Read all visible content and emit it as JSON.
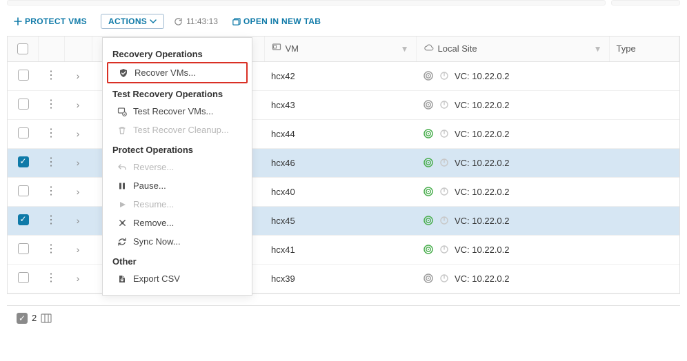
{
  "toolbar": {
    "protect_label": "PROTECT VMS",
    "actions_label": "ACTIONS",
    "time": "11:43:13",
    "open_tab_label": "OPEN IN NEW TAB"
  },
  "menu": {
    "sections": [
      {
        "title": "Recovery Operations",
        "items": [
          {
            "icon": "shield-icon",
            "label": "Recover VMs...",
            "disabled": false,
            "highlighted": true
          }
        ]
      },
      {
        "title": "Test Recovery Operations",
        "items": [
          {
            "icon": "test-recover-icon",
            "label": "Test Recover VMs...",
            "disabled": false
          },
          {
            "icon": "trash-icon",
            "label": "Test Recover Cleanup...",
            "disabled": true
          }
        ]
      },
      {
        "title": "Protect Operations",
        "items": [
          {
            "icon": "reverse-icon",
            "label": "Reverse...",
            "disabled": true
          },
          {
            "icon": "pause-icon",
            "label": "Pause...",
            "disabled": false
          },
          {
            "icon": "resume-icon",
            "label": "Resume...",
            "disabled": true
          },
          {
            "icon": "remove-icon",
            "label": "Remove...",
            "disabled": false
          },
          {
            "icon": "sync-icon",
            "label": "Sync Now...",
            "disabled": false
          }
        ]
      },
      {
        "title": "Other",
        "items": [
          {
            "icon": "export-icon",
            "label": "Export CSV",
            "disabled": false
          }
        ]
      }
    ]
  },
  "columns": {
    "vm": "VM",
    "local_site": "Local Site",
    "type": "Type"
  },
  "rows": [
    {
      "selected": false,
      "vm": "hcx42",
      "status": "gray",
      "site": "VC: 10.22.0.2"
    },
    {
      "selected": false,
      "vm": "hcx43",
      "status": "gray",
      "site": "VC: 10.22.0.2"
    },
    {
      "selected": false,
      "vm": "hcx44",
      "status": "green",
      "site": "VC: 10.22.0.2"
    },
    {
      "selected": true,
      "vm": "hcx46",
      "status": "green",
      "site": "VC: 10.22.0.2"
    },
    {
      "selected": false,
      "vm": "hcx40",
      "status": "green",
      "site": "VC: 10.22.0.2"
    },
    {
      "selected": true,
      "vm": "hcx45",
      "status": "green",
      "site": "VC: 10.22.0.2"
    },
    {
      "selected": false,
      "vm": "hcx41",
      "status": "green",
      "site": "VC: 10.22.0.2"
    },
    {
      "selected": false,
      "vm": "hcx39",
      "status": "gray",
      "site": "VC: 10.22.0.2"
    }
  ],
  "footer": {
    "selected_count": "2"
  },
  "colors": {
    "accent": "#0f7aa8",
    "green": "#4caf50",
    "gray": "#9e9e9e",
    "highlight_red": "#d93025",
    "row_selected": "#d6e6f3"
  }
}
